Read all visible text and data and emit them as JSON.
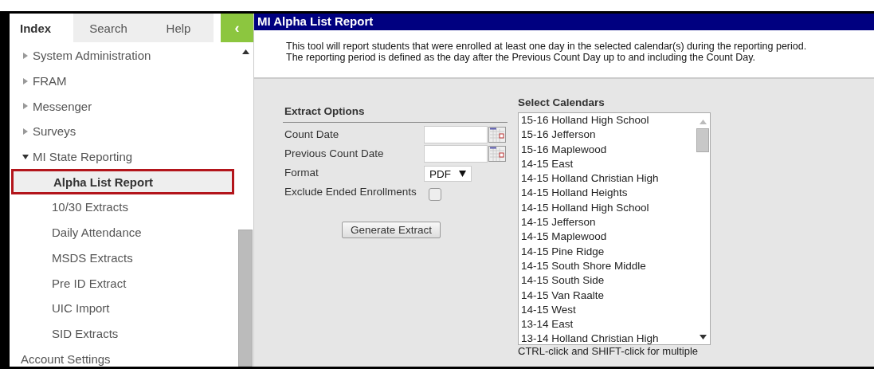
{
  "sidebar": {
    "tabs": [
      {
        "label": "Index",
        "selected": true
      },
      {
        "label": "Search",
        "selected": false
      },
      {
        "label": "Help",
        "selected": false
      }
    ],
    "collapse_button": "‹",
    "items": [
      {
        "label": "System Administration",
        "expanded": false
      },
      {
        "label": "FRAM",
        "expanded": false
      },
      {
        "label": "Messenger",
        "expanded": false
      },
      {
        "label": "Surveys",
        "expanded": false
      },
      {
        "label": "MI State Reporting",
        "expanded": true,
        "children": [
          {
            "label": "Alpha List Report",
            "selected": true
          },
          {
            "label": "10/30 Extracts",
            "selected": false
          },
          {
            "label": "Daily Attendance",
            "selected": false
          },
          {
            "label": "MSDS Extracts",
            "selected": false
          },
          {
            "label": "Pre ID Extract",
            "selected": false
          },
          {
            "label": "UIC Import",
            "selected": false
          },
          {
            "label": "SID Extracts",
            "selected": false
          }
        ]
      },
      {
        "label": "Account Settings"
      }
    ]
  },
  "report": {
    "title": "MI Alpha List Report",
    "description": [
      "This tool will report students that were enrolled at least one day in the selected calendar(s) during the reporting period.",
      "The reporting period is defined as the day after the Previous Count Day up to and including the Count Day."
    ],
    "extract_options": {
      "heading": "Extract Options",
      "count_date_label": "Count Date",
      "previous_count_date_label": "Previous Count Date",
      "format_label": "Format",
      "format_value": "PDF",
      "exclude_label": "Exclude Ended Enrollments",
      "exclude_checked": false,
      "generate_button": "Generate Extract"
    },
    "calendars": {
      "heading": "Select Calendars",
      "items": [
        "15-16 Holland High School",
        "15-16 Jefferson",
        "15-16 Maplewood",
        "14-15 East",
        "14-15 Holland Christian High",
        "14-15 Holland Heights",
        "14-15 Holland High School",
        "14-15 Jefferson",
        "14-15 Maplewood",
        "14-15 Pine Ridge",
        "14-15 South Shore Middle",
        "14-15 South Side",
        "14-15 Van Raalte",
        "14-15 West",
        "13-14 East",
        "13-14 Holland Christian High"
      ],
      "hint": "CTRL-click and SHIFT-click for multiple"
    }
  }
}
